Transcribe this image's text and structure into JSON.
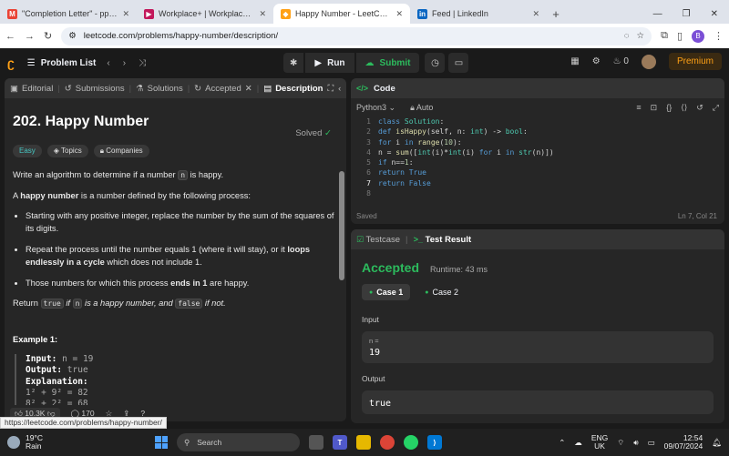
{
  "browser": {
    "tabs": [
      {
        "label": "\"Completion Letter\" - ppratap",
        "icon": "M",
        "color": "#ea4335"
      },
      {
        "label": "Workplace+ | Workplace+ cale",
        "icon": "▶",
        "color": "#c2185b"
      },
      {
        "label": "Happy Number - LeetCode",
        "icon": "◆",
        "color": "#ffa116"
      },
      {
        "label": "Feed | LinkedIn",
        "icon": "in",
        "color": "#0a66c2"
      }
    ],
    "new_tab": "+",
    "url": "leetcode.com/problems/happy-number/description/",
    "profile_initial": "B"
  },
  "lc_header": {
    "problem_list": "Problem List",
    "run": "Run",
    "submit": "Submit",
    "streak": "0",
    "premium": "Premium"
  },
  "left_tabs": [
    "Editorial",
    "Submissions",
    "Solutions",
    "Accepted",
    "Description"
  ],
  "problem": {
    "title": "202. Happy Number",
    "solved": "Solved",
    "tags": [
      "Easy",
      "Topics",
      "Companies"
    ],
    "p1_a": "Write an algorithm to determine if a number ",
    "p1_code": "n",
    "p1_b": " is happy.",
    "p2_a": "A ",
    "p2_bold": "happy number",
    "p2_b": " is a number defined by the following process:",
    "li1": "Starting with any positive integer, replace the number by the sum of the squares of its digits.",
    "li2_a": "Repeat the process until the number equals 1 (where it will stay), or it ",
    "li2_bold": "loops endlessly in a cycle",
    "li2_b": " which does not include 1.",
    "li3_a": "Those numbers for which this process ",
    "li3_bold": "ends in 1",
    "li3_b": " are happy.",
    "ret_a": "Return ",
    "ret_true": "true",
    "ret_b": " if ",
    "ret_n": "n",
    "ret_c": " is a happy number, and ",
    "ret_false": "false",
    "ret_d": " if not.",
    "example_title": "Example 1:",
    "ex_input_label": "Input:",
    "ex_input": "n = 19",
    "ex_output_label": "Output:",
    "ex_output": "true",
    "ex_expl_label": "Explanation:",
    "ex_line1": "1² + 9² = 82",
    "ex_line2": "8² + 2² = 68"
  },
  "left_footer": {
    "likes": "10.3K",
    "comments": "170"
  },
  "status_url": "https://leetcode.com/problems/happy-number/",
  "code_panel": {
    "title": "Code",
    "language": "Python3",
    "auto": "Auto",
    "saved": "Saved",
    "position": "Ln 7, Col 21"
  },
  "test_panel": {
    "tab1": "Testcase",
    "tab2": "Test Result",
    "status": "Accepted",
    "runtime": "Runtime: 43 ms",
    "case1": "Case 1",
    "case2": "Case 2",
    "input_label": "Input",
    "input_key": "n =",
    "input_val": "19",
    "output_label": "Output",
    "output_val": "true"
  },
  "taskbar": {
    "temp": "19°C",
    "weather": "Rain",
    "search": "Search",
    "lang1": "ENG",
    "lang2": "UK",
    "time": "12:54",
    "date": "09/07/2024"
  }
}
